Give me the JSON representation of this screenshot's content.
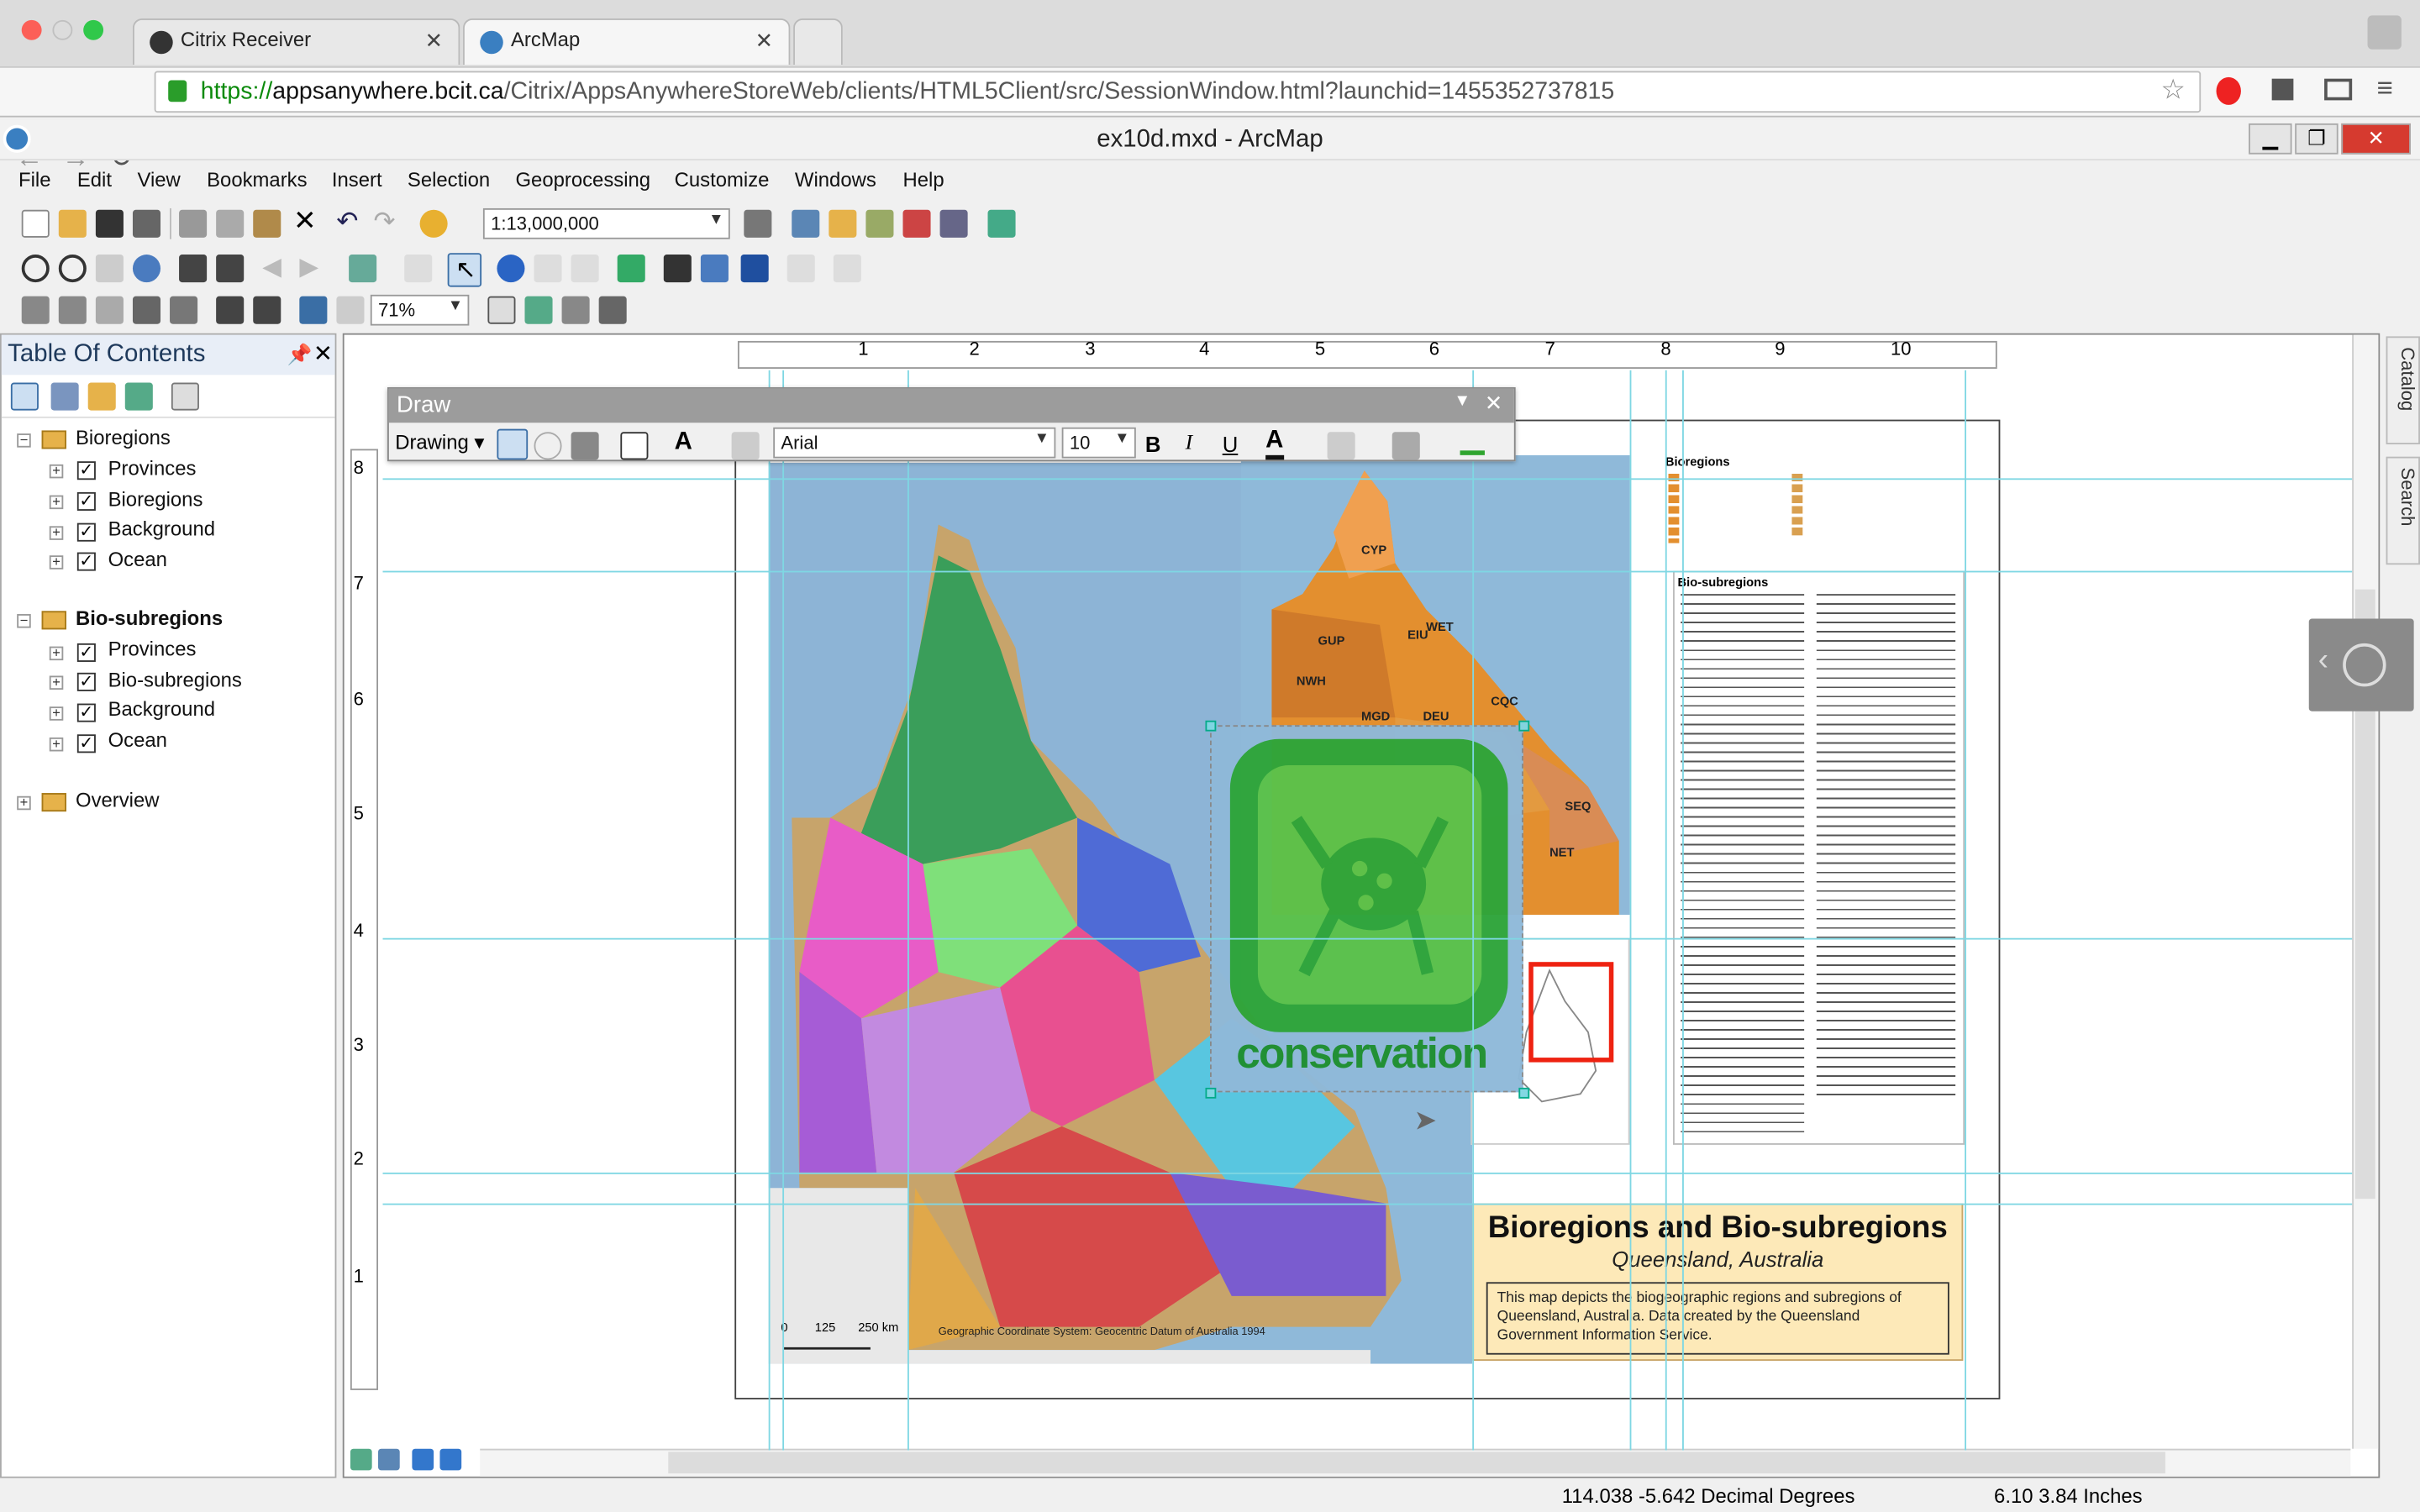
{
  "browser": {
    "tabs": [
      {
        "label": "Citrix Receiver"
      },
      {
        "label": "ArcMap"
      }
    ],
    "url": {
      "scheme": "https://",
      "host": "appsanywhere.bcit.ca",
      "path": "/Citrix/AppsAnywhereStoreWeb/clients/HTML5Client/src/SessionWindow.html?launchid=1455352737815"
    }
  },
  "app": {
    "title": "ex10d.mxd - ArcMap"
  },
  "menu": [
    "File",
    "Edit",
    "View",
    "Bookmarks",
    "Insert",
    "Selection",
    "Geoprocessing",
    "Customize",
    "Windows",
    "Help"
  ],
  "toolbar": {
    "scale": "1:13,000,000",
    "zoom": "71%"
  },
  "toc": {
    "title": "Table Of Contents",
    "groups": [
      {
        "name": "Bioregions",
        "layers": [
          "Provinces",
          "Bioregions",
          "Background",
          "Ocean"
        ]
      },
      {
        "name": "Bio-subregions",
        "layers": [
          "Provinces",
          "Bio-subregions",
          "Background",
          "Ocean"
        ]
      },
      {
        "name": "Overview",
        "layers": []
      }
    ]
  },
  "draw": {
    "title": "Draw",
    "menu": "Drawing",
    "font": "Arial",
    "size": "10",
    "bold": "B",
    "italic": "I",
    "underline": "U"
  },
  "ruler": {
    "top": [
      "1",
      "2",
      "3",
      "4",
      "5",
      "6",
      "7",
      "8",
      "9",
      "10"
    ],
    "left": [
      "8",
      "7",
      "6",
      "5",
      "4",
      "3",
      "2",
      "1"
    ]
  },
  "map": {
    "title": "Bioregions and Bio-subregions",
    "subtitle": "Queensland, Australia",
    "description": "This map depicts the biogeographic regions and subregions of Queensland, Australia. Data created by the Queensland Government Information Service.",
    "logo_text": "conservation",
    "legend1_title": "Bioregions",
    "legend2_title": "Bio-subregions",
    "coord_system": "Geographic Coordinate System: Geocentric Datum of Australia 1994",
    "scalebar": [
      "0",
      "125",
      "250 km"
    ],
    "region_labels": [
      "CYP",
      "GUP",
      "EIU",
      "WET",
      "NWH",
      "MGD",
      "DEU",
      "CQC",
      "SEQ",
      "NET"
    ],
    "colors": {
      "ocean": "#8fb9d9",
      "land_orange": "#e38f2f",
      "logo_green": "#2ea53a",
      "title_box": "#fde9b8"
    }
  },
  "side_panels": [
    "Catalog",
    "Search"
  ],
  "status": {
    "coords": "114.038  -5.642 Decimal Degrees",
    "page": "6.10  3.84 Inches"
  }
}
